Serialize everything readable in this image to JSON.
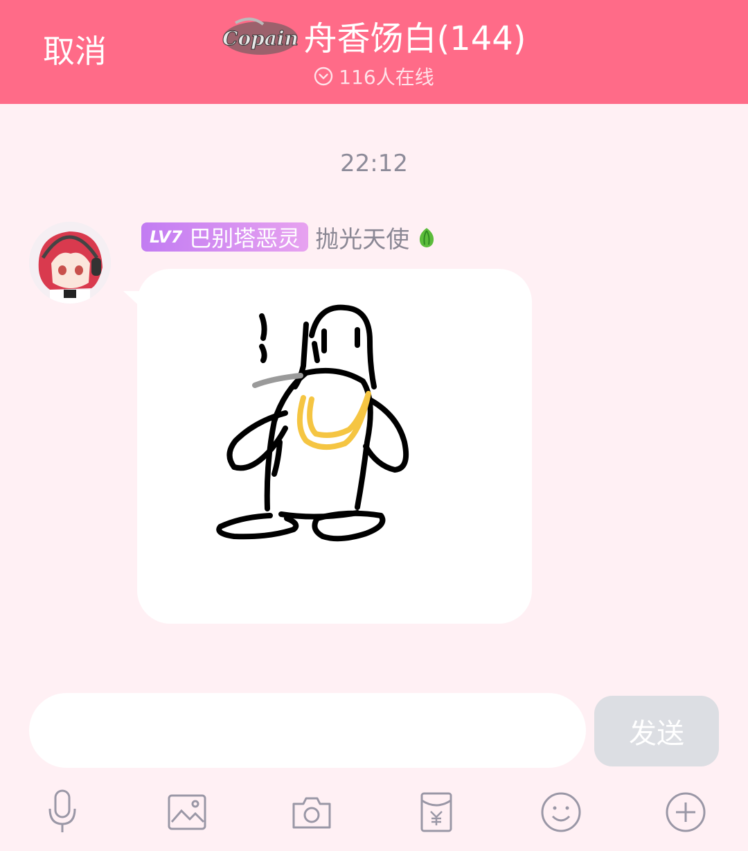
{
  "header": {
    "cancel_label": "取消",
    "group_title": "舟香饧白(144)",
    "online_text": "116人在线",
    "logo_text": "Copain"
  },
  "chat": {
    "timestamp": "22:12",
    "message": {
      "level_badge": "LV7",
      "title_badge": "巴别塔恶灵",
      "sender_name": "抛光天使",
      "content_type": "drawing-penguin"
    }
  },
  "composer": {
    "input_value": "",
    "input_placeholder": "",
    "send_label": "发送"
  },
  "toolbar": {
    "items": [
      "microphone-icon",
      "image-icon",
      "camera-icon",
      "red-envelope-icon",
      "emoji-icon",
      "plus-icon"
    ]
  },
  "colors": {
    "header_bg": "#ff6b88",
    "chat_bg": "#fff0f4",
    "badge_start": "#c27cf2",
    "badge_end": "#e7a2f0",
    "send_disabled": "#dcdee3"
  }
}
